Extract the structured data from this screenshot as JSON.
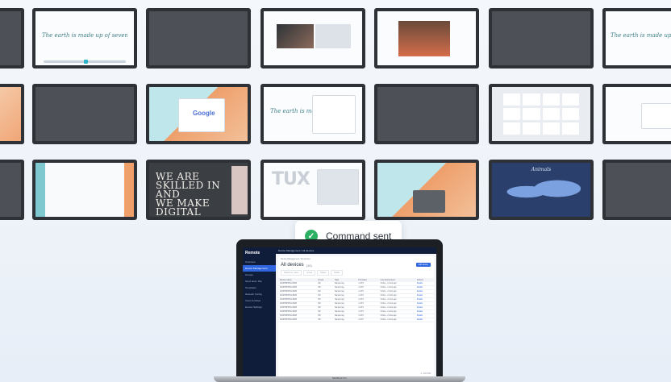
{
  "wall": {
    "handwriting": "The earth is made up of seven continents",
    "handwriting_short": "The earth is made",
    "google": "Google",
    "big_type": [
      "WE ARE",
      "SKILLED IN",
      "AND",
      "WE MAKE",
      "DIGITAL"
    ],
    "tux": "TUX",
    "map_title": "Animals"
  },
  "toast": {
    "icon": "check-circle-icon",
    "message": "Command sent",
    "color": "#2db063"
  },
  "laptop_app": {
    "brand": "Remote",
    "nav": [
      "Overview",
      "Device Management",
      "Groups",
      "Send task / File",
      "Templates",
      "Network Config",
      "Users & Roles",
      "Device Settings"
    ],
    "path": "Device Management / All devices",
    "title": "All devices",
    "count": "(10)",
    "add_button": "Add device",
    "filters": [
      "Search by name",
      "Group",
      "Status",
      "Model"
    ],
    "columns": [
      "Device name",
      "Group",
      "Tags",
      "Firmware",
      "Last announced",
      "Actions"
    ],
    "rows": [
      [
        "2323HDP9HLC2528",
        "ND",
        "Sample tag",
        "1.23.5",
        "Online - 2 mins ago",
        "Details"
      ],
      [
        "2323HDP9HLC2528",
        "ND",
        "Sample tag",
        "1.23.5",
        "Online - 2 mins ago",
        "Details"
      ],
      [
        "2323HDP9HLC2528",
        "ND",
        "Sample tag",
        "1.23.5",
        "Online - 2 mins ago",
        "Details"
      ],
      [
        "2323HDP9HLC2528",
        "ND",
        "Sample tag",
        "1.23.5",
        "Online - 2 mins ago",
        "Details"
      ],
      [
        "2323HDP9HLC2528",
        "ND",
        "Sample tag",
        "1.23.5",
        "Online - 2 mins ago",
        "Details"
      ],
      [
        "2323HDP9HLC2528",
        "ND",
        "Sample tag",
        "1.23.5",
        "Online - 2 mins ago",
        "Details"
      ],
      [
        "2323HDP9HLC2528",
        "ND",
        "Sample tag",
        "1.23.5",
        "Online - 2 mins ago",
        "Details"
      ],
      [
        "2323HDP9HLC2528",
        "ND",
        "Sample tag",
        "1.23.5",
        "Online - 2 mins ago",
        "Details"
      ],
      [
        "2323HDP9HLC2528",
        "ND",
        "Sample tag",
        "1.23.5",
        "Online - 2 mins ago",
        "Details"
      ],
      [
        "2323HDP9HLC2528",
        "ND",
        "Sample tag",
        "1.23.5",
        "Online - 2 mins ago",
        "Details"
      ]
    ],
    "pager": "1 - 10 of 10",
    "laptop_label": "MacBook Pro"
  }
}
